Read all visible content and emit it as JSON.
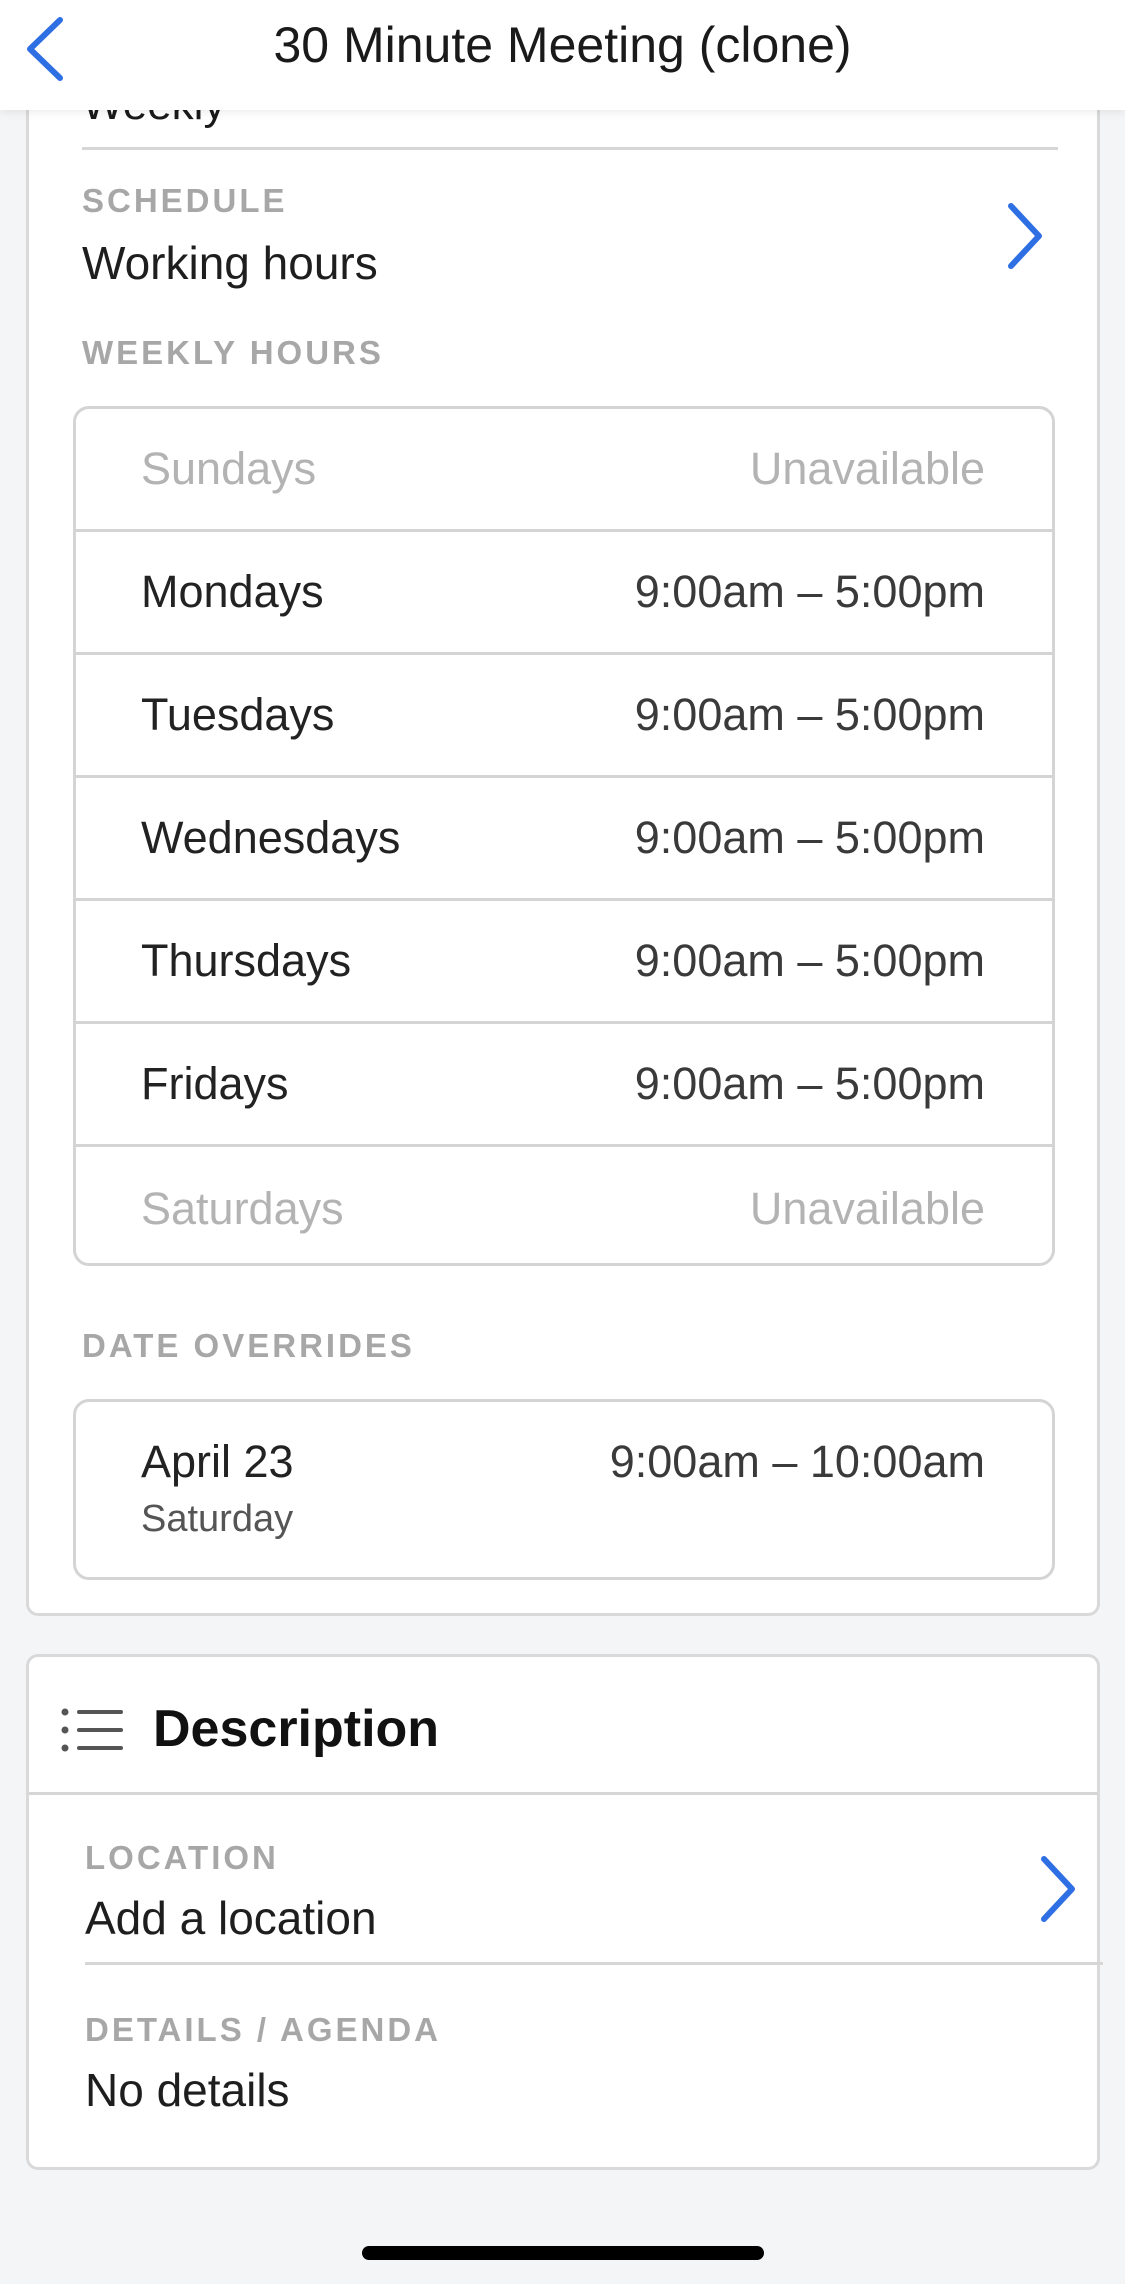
{
  "header": {
    "title": "30 Minute Meeting (clone)"
  },
  "availability": {
    "partial_value": "Weekly",
    "schedule": {
      "label": "SCHEDULE",
      "value": "Working hours"
    },
    "weekly_hours_label": "WEEKLY HOURS",
    "weekly_hours": [
      {
        "day": "Sundays",
        "time": "Unavailable"
      },
      {
        "day": "Mondays",
        "time": "9:00am – 5:00pm"
      },
      {
        "day": "Tuesdays",
        "time": "9:00am – 5:00pm"
      },
      {
        "day": "Wednesdays",
        "time": "9:00am – 5:00pm"
      },
      {
        "day": "Thursdays",
        "time": "9:00am – 5:00pm"
      },
      {
        "day": "Fridays",
        "time": "9:00am – 5:00pm"
      },
      {
        "day": "Saturdays",
        "time": "Unavailable"
      }
    ],
    "date_overrides_label": "DATE OVERRIDES",
    "date_override": {
      "date": "April 23",
      "weekday": "Saturday",
      "time": "9:00am – 10:00am"
    }
  },
  "description_section": {
    "title": "Description",
    "location": {
      "label": "LOCATION",
      "value": "Add a location"
    },
    "details": {
      "label": "DETAILS / AGENDA",
      "value": "No details"
    }
  },
  "colors": {
    "accent": "#2f6fe4",
    "muted": "#a7a7a7",
    "border": "#d4d4d4"
  },
  "icons": {
    "back": "chevron-left-icon",
    "forward": "chevron-right-icon",
    "description": "list-icon"
  }
}
